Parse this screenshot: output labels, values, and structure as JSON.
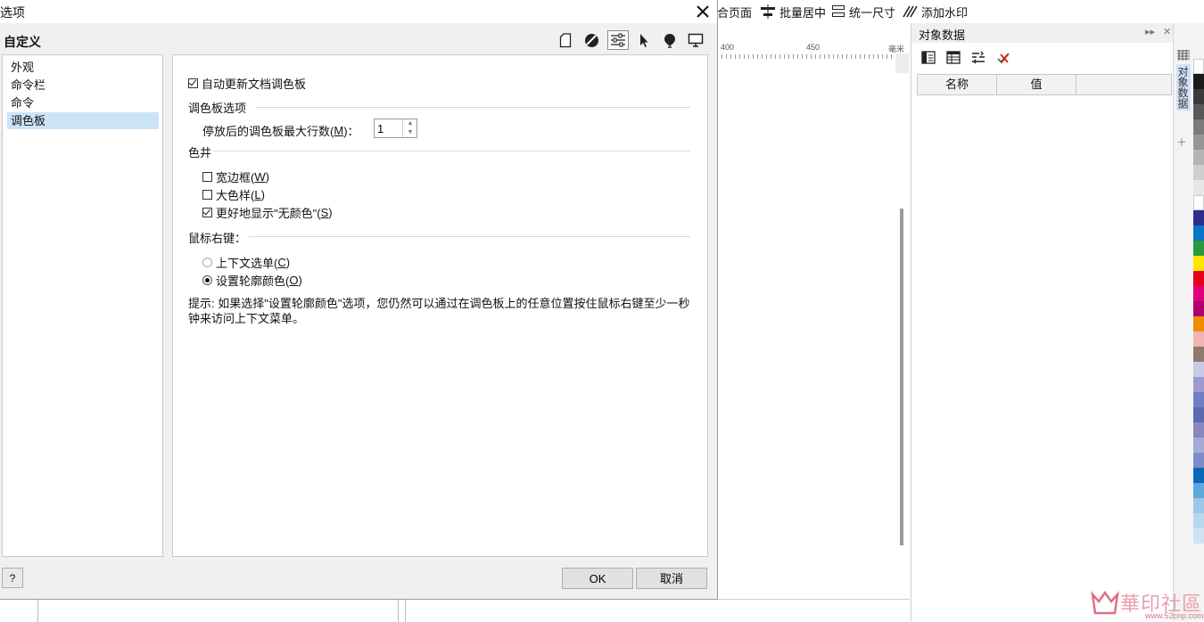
{
  "dialog": {
    "title": "选项",
    "section_title": "自定义",
    "category_icons": [
      "page-icon",
      "color-mgmt-icon",
      "sliders-icon",
      "pointer-icon",
      "balloon-icon",
      "monitor-icon"
    ],
    "tree_items": [
      "外观",
      "命令栏",
      "命令",
      "调色板"
    ],
    "selected_tree_item": "调色板",
    "content": {
      "auto_update_label": "自动更新文档调色板",
      "palette_options_title": "调色板选项",
      "max_rows_label_prefix": "停放后的调色板最大行数(",
      "max_rows_mnemonic": "M",
      "max_rows_label_suffix": ")：",
      "max_rows_value": "1",
      "color_well_title": "色井",
      "wide_border_prefix": "宽边框(",
      "wide_border_mnemonic": "W",
      "large_swatch_prefix": "大色样(",
      "large_swatch_mnemonic": "L",
      "better_display_prefix": "更好地显示\"无颜色\"(",
      "better_display_mnemonic": "S",
      "close_paren": ")",
      "right_mouse_title": "鼠标右键：",
      "context_menu_prefix": "上下文选单(",
      "context_menu_mnemonic": "C",
      "set_outline_prefix": "设置轮廓颜色(",
      "set_outline_mnemonic": "O",
      "hint": "提示: 如果选择\"设置轮廓颜色\"选项，您仍然可以通过在调色板上的任意位置按住鼠标右键至少一秒钟来访问上下文菜单。",
      "checkbox_states": {
        "auto_update": true,
        "wide_border": false,
        "large_swatch": false,
        "better_display": true
      },
      "right_mouse_selected": "set_outline"
    },
    "buttons": {
      "help": "?",
      "ok": "OK",
      "cancel": "取消"
    }
  },
  "app": {
    "toolbar": {
      "fit_page": "合页面",
      "batch_center": "批量居中",
      "unify_size": "统一尺寸",
      "add_watermark": "添加水印"
    },
    "ruler": {
      "tick_400": "400",
      "tick_450": "450",
      "unit": "毫米"
    },
    "object_data": {
      "title": "对象数据",
      "col_name": "名称",
      "col_value": "值",
      "side_tab": "对象数据"
    },
    "palette_colors": [
      "#ffffff",
      "#1a1a1a",
      "#3a3a3a",
      "#595959",
      "#7a7a7a",
      "#969696",
      "#b3b3b3",
      "#cfcfcf",
      "#e6e6e6",
      "#ffffff",
      "#2b2e8c",
      "#0b74c9",
      "#2a9a3f",
      "#ffe600",
      "#e6001e",
      "#e0007a",
      "#b0006e",
      "#f08c00",
      "#f2b3b3",
      "#8c7b6e",
      "#c9c9e8",
      "#9b9bd1",
      "#6f7fc4",
      "#5a6bb0",
      "#8888c0",
      "#a9a9d6",
      "#7d8cc8",
      "#0a68b8",
      "#5fa8dc",
      "#9cc8e8",
      "#b8d8ee",
      "#cfe3f2"
    ],
    "watermark": {
      "text": "華印社區",
      "url": "www.52cnp.com"
    }
  }
}
